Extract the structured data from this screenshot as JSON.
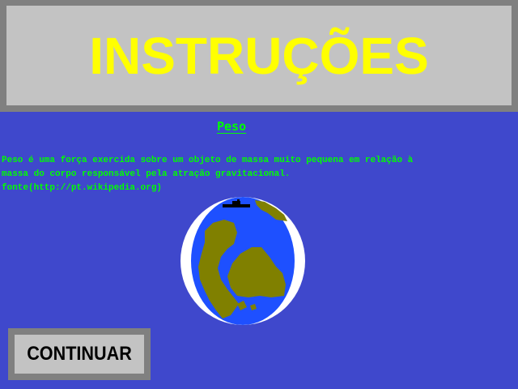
{
  "header": {
    "title": "INSTRUÇÕES"
  },
  "section": {
    "heading": "Peso",
    "description_line1": "Peso é uma força exercida sobre um objeto de massa muito pequena em relação à",
    "description_line2": "massa do corpo responsável pela atração gravitacional.",
    "source": "fonte(http://pt.wikipedia.org)"
  },
  "buttons": {
    "continue_label": "CONTINUAR"
  },
  "colors": {
    "background": "#3f48cc",
    "title": "#ffff00",
    "text": "#00ff00",
    "panel": "#c3c3c3",
    "panel_border": "#808080",
    "ocean": "#1e50ff",
    "land": "#808000"
  },
  "icons": {
    "planet": "earth-globe-icon",
    "ship": "ship-icon"
  }
}
